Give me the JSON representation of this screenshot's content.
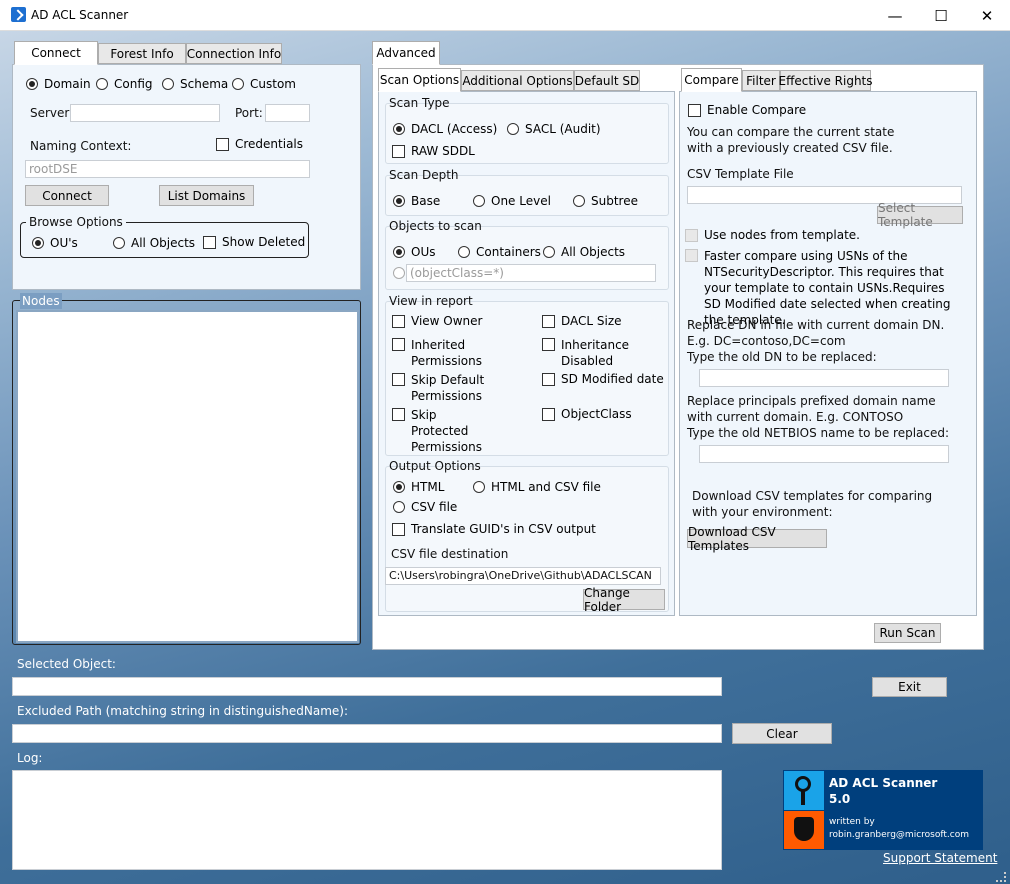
{
  "window": {
    "title": "AD ACL Scanner",
    "minimize": "—",
    "maximize": "☐",
    "close": "✕"
  },
  "left_tabs": {
    "connect": "Connect",
    "forest": "Forest Info",
    "conninfo": "Connection Info"
  },
  "connect": {
    "domain": "Domain",
    "config": "Config",
    "schema": "Schema",
    "custom": "Custom",
    "server_label": "Server:",
    "port_label": "Port:",
    "naming_label": "Naming Context:",
    "credentials": "Credentials",
    "naming_value": "rootDSE",
    "connect_btn": "Connect",
    "list_domains_btn": "List Domains",
    "browse_label": "Browse Options",
    "ous": "OU's",
    "all_objects": "All Objects",
    "show_deleted": "Show Deleted"
  },
  "nodes_label": "Nodes",
  "advanced_tab": "Advanced",
  "scan_tabs": {
    "scan": "Scan Options",
    "additional": "Additional Options",
    "default_sd": "Default SD"
  },
  "scan_type": {
    "label": "Scan Type",
    "dacl": "DACL (Access)",
    "sacl": "SACL (Audit)",
    "raw": "RAW SDDL"
  },
  "scan_depth": {
    "label": "Scan Depth",
    "base": "Base",
    "one": "One Level",
    "subtree": "Subtree"
  },
  "objects": {
    "label": "Objects to scan",
    "ous": "OUs",
    "containers": "Containers",
    "all": "All Objects",
    "filter_placeholder": "(objectClass=*)"
  },
  "view": {
    "label": "View in report",
    "owner": "View Owner",
    "inherited": "Inherited Permissions",
    "skip_default": "Skip Default Permissions",
    "skip_protected": "Skip Protected Permissions",
    "dacl_size": "DACL Size",
    "inherit_disabled": "Inheritance Disabled",
    "sd_modified": "SD Modified date",
    "objectclass": "ObjectClass"
  },
  "output": {
    "label": "Output Options",
    "html": "HTML",
    "html_csv": "HTML and CSV file",
    "csv": "CSV file",
    "translate": "Translate GUID's in CSV output",
    "dest_label": "CSV file destination",
    "dest_value": "C:\\Users\\robingra\\OneDrive\\Github\\ADACLSCAN",
    "change_folder": "Change Folder"
  },
  "right_tabs": {
    "compare": "Compare",
    "filter": "Filter",
    "effective": "Effective Rights"
  },
  "compare": {
    "enable": "Enable Compare",
    "desc": "You can compare the current state with a previously created CSV file.",
    "template_label": "CSV Template File",
    "select_template": "Select Template",
    "use_nodes": "Use nodes from template.",
    "faster": "Faster compare using USNs of the NTSecurityDescriptor. This requires that your template to contain USNs.Requires SD Modified date selected when creating the template.",
    "replace_dn": "Replace DN in file with current domain DN.",
    "replace_dn_eg": "E.g. DC=contoso,DC=com",
    "replace_dn_type": "Type the old DN to be replaced:",
    "replace_principals": "Replace principals prefixed domain name with current domain. E.g. CONTOSO",
    "replace_netbios": "Type the old NETBIOS name to be replaced:",
    "download_desc": "Download CSV templates for comparing with your environment:",
    "download_btn": "Download CSV Templates"
  },
  "run_scan": "Run Scan",
  "selected_label": "Selected Object:",
  "exit": "Exit",
  "excluded_label": "Excluded Path (matching string in distinguishedName):",
  "clear": "Clear",
  "log_label": "Log:",
  "badge": {
    "title": "AD ACL Scanner",
    "version": "5.0",
    "written": "written by",
    "email": "robin.granberg@microsoft.com"
  },
  "support": "Support Statement",
  "colors": {
    "badge_bg": "#003f7d",
    "badge_icon_top": "#1aa3e8",
    "badge_icon_bottom": "#ff5a00"
  }
}
